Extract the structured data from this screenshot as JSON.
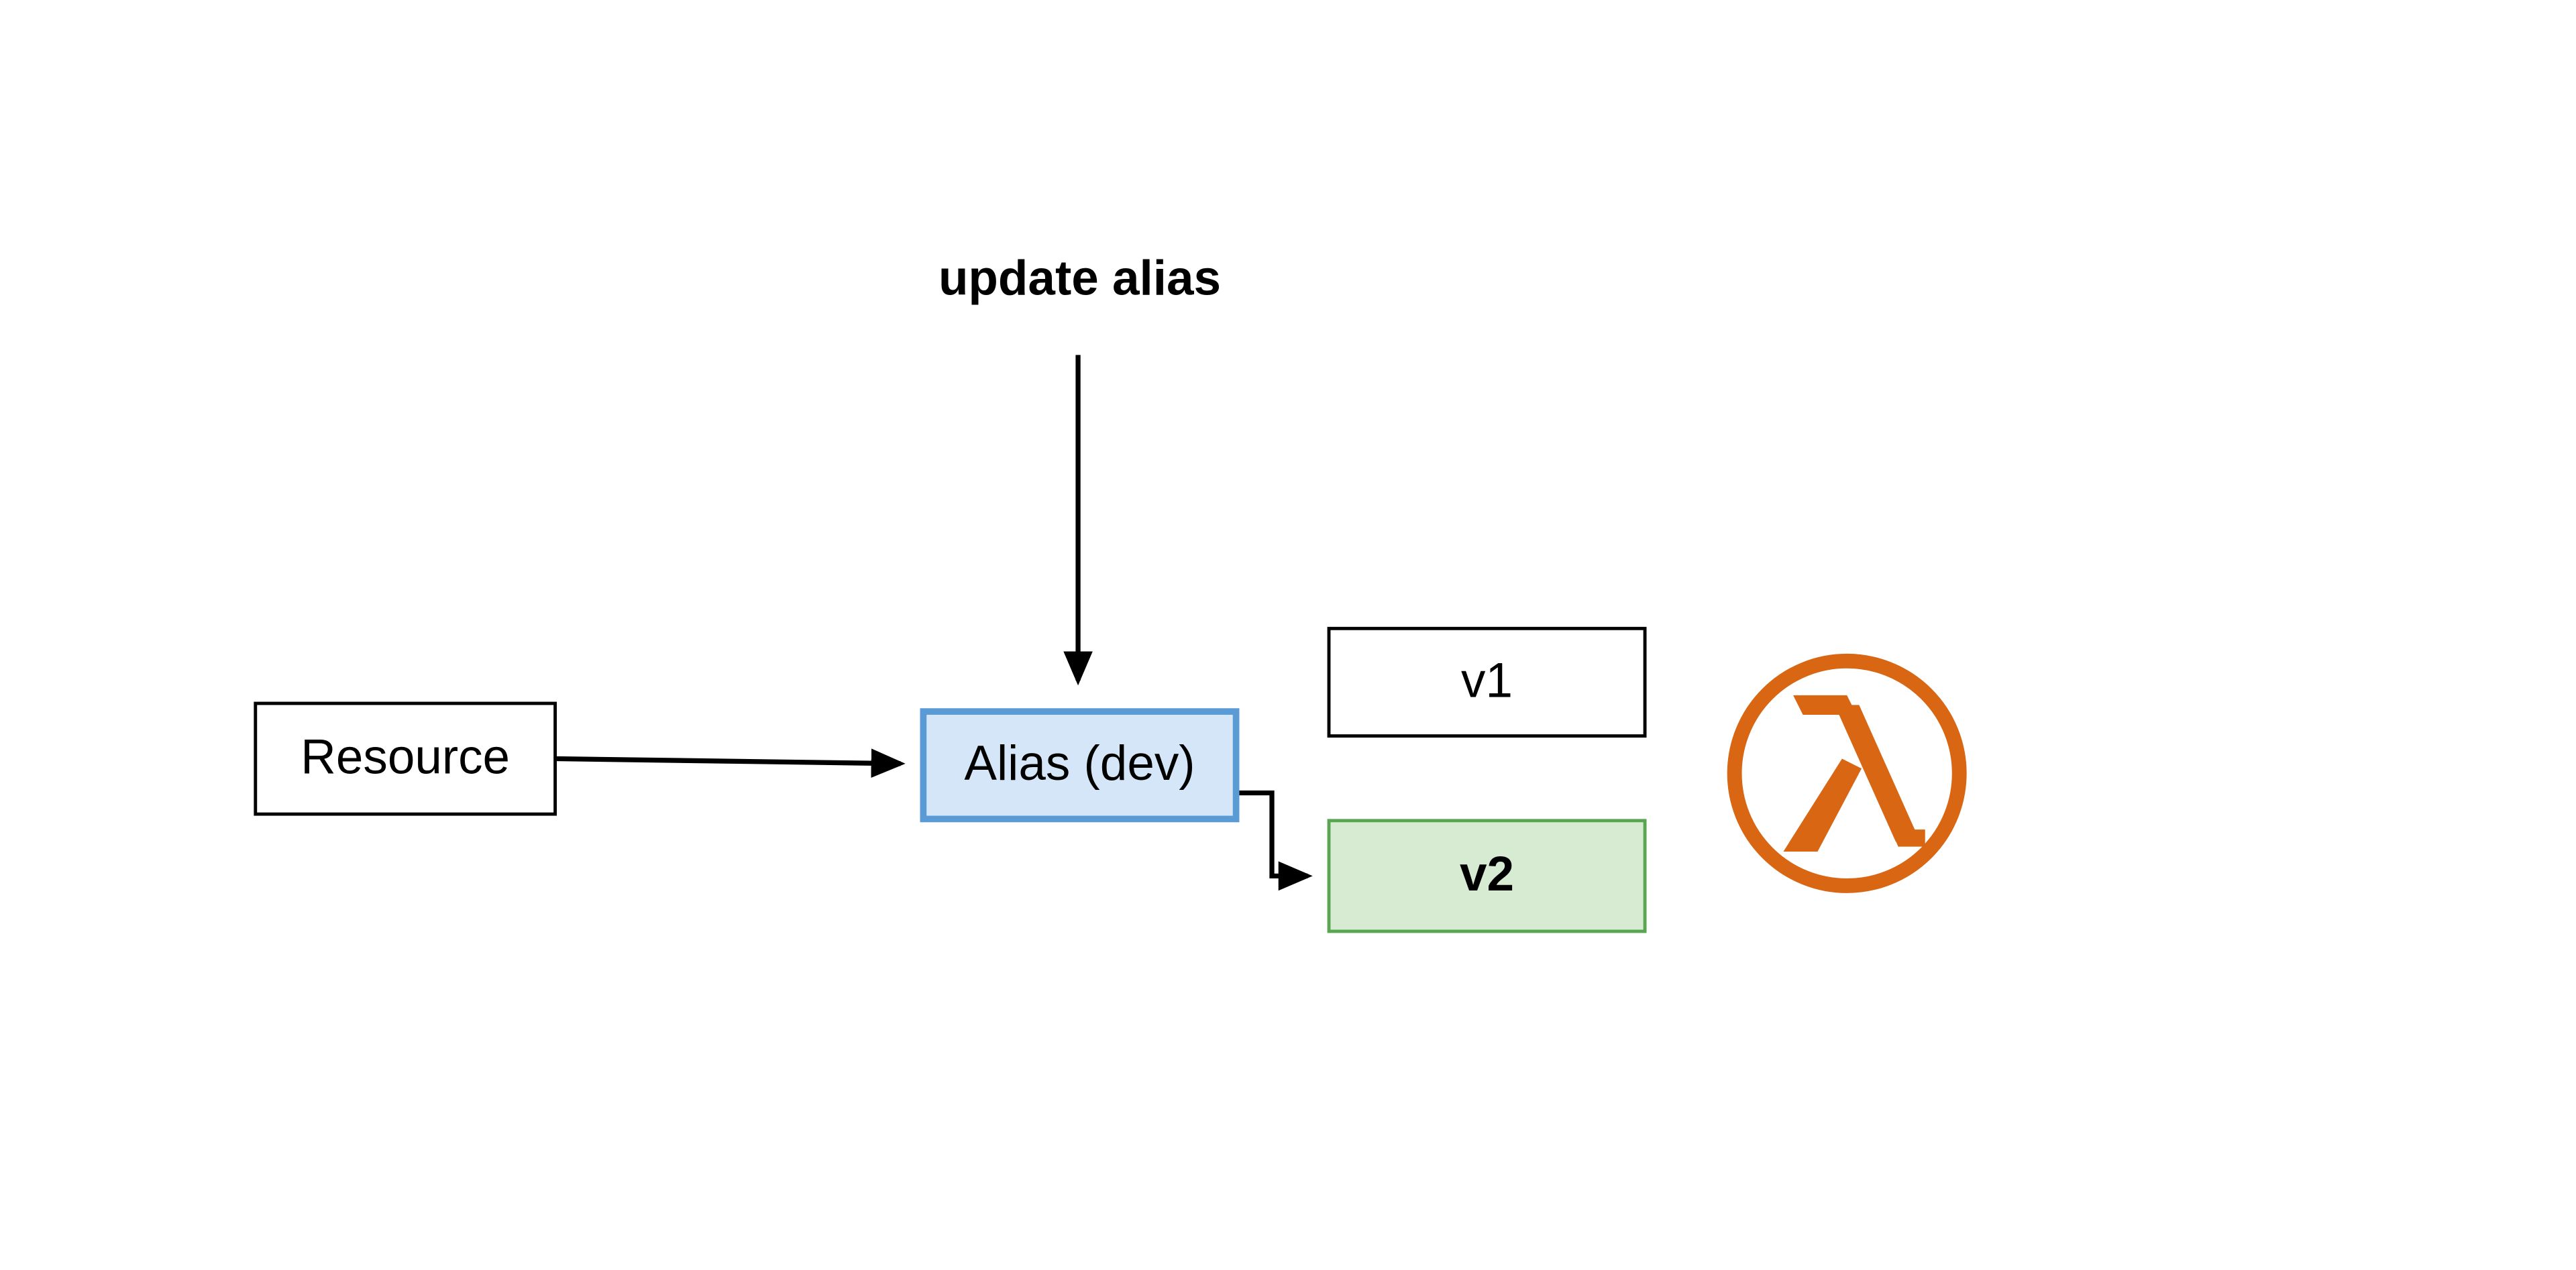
{
  "diagram": {
    "update_label": "update alias",
    "resource_label": "Resource",
    "alias_label": "Alias (dev)",
    "v1_label": "v1",
    "v2_label": "v2",
    "lambda_icon_name": "aws-lambda-icon",
    "colors": {
      "alias_fill": "#d4e6f8",
      "alias_border": "#5b9bd5",
      "v2_fill": "#d6ebd2",
      "v2_border": "#5aa552",
      "lambda_orange": "#d86613"
    },
    "flow": [
      {
        "from": "Resource",
        "to": "Alias (dev)"
      },
      {
        "from": "update alias",
        "to": "Alias (dev)"
      },
      {
        "from": "Alias (dev)",
        "to": "v2"
      }
    ],
    "versions": [
      "v1",
      "v2"
    ],
    "active_version": "v2"
  }
}
